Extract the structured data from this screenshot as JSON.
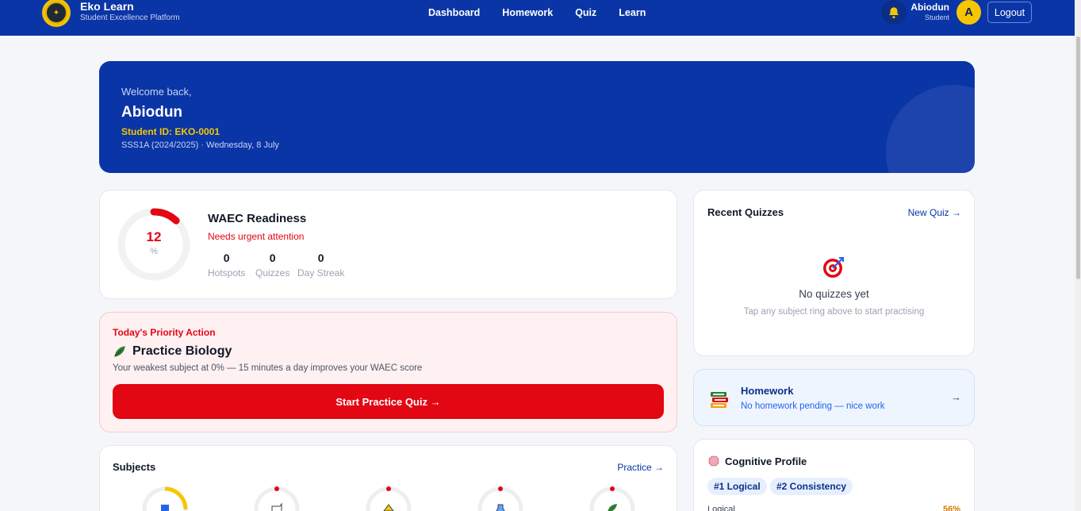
{
  "header": {
    "brand_name": "Eko Learn",
    "brand_tagline": "Student Excellence Platform",
    "nav": [
      "Dashboard",
      "Homework",
      "Quiz",
      "Learn"
    ],
    "user_name": "Abiodun",
    "user_role": "Student",
    "avatar_initial": "A",
    "logout_label": "Logout"
  },
  "welcome": {
    "greeting": "Welcome back,",
    "name": "Abiodun",
    "student_id": "Student ID: EKO-0001",
    "class_info": "SSS1A (2024/2025) · Wednesday, 8 July"
  },
  "waec": {
    "title": "WAEC Readiness",
    "score": "12",
    "unit": "%",
    "score_fraction": 0.12,
    "status": "Needs urgent attention",
    "stats": [
      {
        "value": "0",
        "label": "Hotspots"
      },
      {
        "value": "0",
        "label": "Quizzes"
      },
      {
        "value": "0",
        "label": "Day Streak"
      }
    ]
  },
  "priority": {
    "label": "Today's Priority Action",
    "title": "Practice Biology",
    "description": "Your weakest subject at 0% — 15 minutes a day improves your WAEC score",
    "button": "Start Practice Quiz →"
  },
  "subjects": {
    "title": "Subjects",
    "link": "Practice →"
  },
  "quizzes": {
    "title": "Recent Quizzes",
    "link": "New Quiz →",
    "empty_title": "No quizzes yet",
    "empty_hint": "Tap any subject ring above to start practising"
  },
  "homework": {
    "title": "Homework",
    "status": "No homework pending — nice work",
    "arrow": "→"
  },
  "cognitive": {
    "title": "Cognitive Profile",
    "tags": [
      "#1 Logical",
      "#2 Consistency"
    ],
    "row_label": "Logical",
    "row_value": "56%"
  },
  "colors": {
    "primary": "#0a35a6",
    "accent_yellow": "#f6c700",
    "danger": "#e30613"
  }
}
